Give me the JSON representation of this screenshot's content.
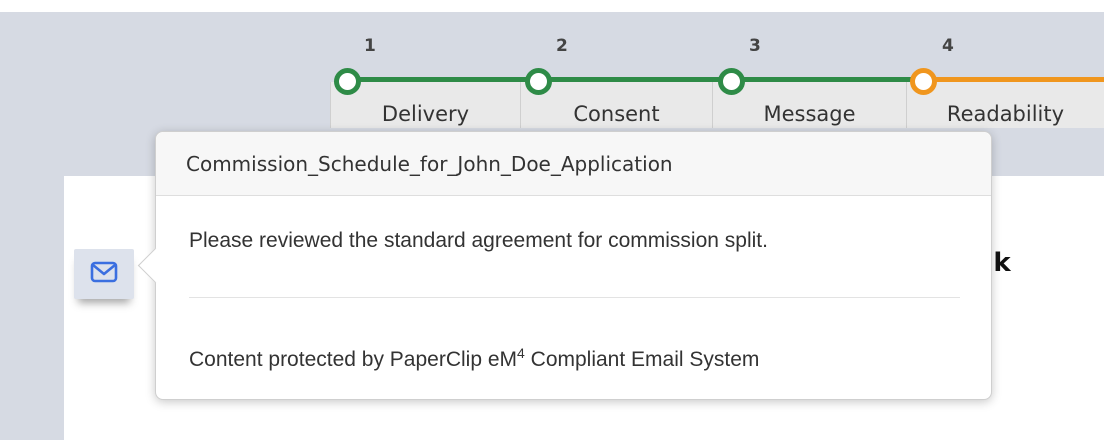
{
  "steps": [
    {
      "number": "1",
      "label": "Delivery",
      "status": "complete"
    },
    {
      "number": "2",
      "label": "Consent",
      "status": "complete"
    },
    {
      "number": "3",
      "label": "Message",
      "status": "complete"
    },
    {
      "number": "4",
      "label": "Readability",
      "status": "current"
    }
  ],
  "colors": {
    "complete": "#2e8b47",
    "current": "#f0961e",
    "mail_icon": "#3b6fe0"
  },
  "heading_fragment": "ck",
  "popover": {
    "title": "Commission_Schedule_for_John_Doe_Application",
    "message": "Please reviewed the standard agreement for commission split.",
    "footer_prefix": "Content protected by PaperClip eM",
    "footer_sup": "4",
    "footer_suffix": " Compliant Email System"
  },
  "icons": {
    "mail": "envelope-icon"
  }
}
